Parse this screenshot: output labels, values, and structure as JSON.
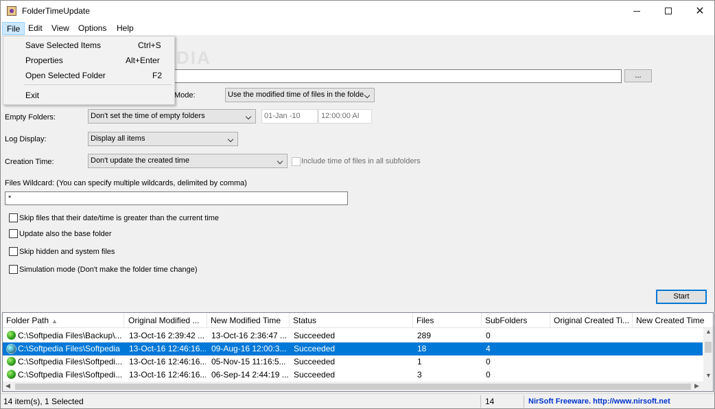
{
  "window": {
    "title": "FolderTimeUpdate"
  },
  "menubar": {
    "items": [
      "File",
      "Edit",
      "View",
      "Options",
      "Help"
    ]
  },
  "file_menu": {
    "items": [
      {
        "label": "Save Selected Items",
        "accel": "Ctrl+S"
      },
      {
        "label": "Properties",
        "accel": "Alt+Enter"
      },
      {
        "label": "Open Selected Folder",
        "accel": "F2"
      },
      {
        "label": "Exit",
        "accel": ""
      }
    ]
  },
  "watermark": "SOFTPEDIA",
  "form": {
    "browse_label": "...",
    "mode_label": "Mode:",
    "mode_value": "Use the modified time of files in the folde",
    "empty_label": "Empty Folders:",
    "empty_value": "Don't set the time of empty folders",
    "empty_date": "01-Jan -10",
    "empty_time": "12:00:00 AI",
    "log_label": "Log Display:",
    "log_value": "Display all items",
    "creation_label": "Creation Time:",
    "creation_value": "Don't update the created time",
    "include_subfolders": "Include time of files in all subfolders",
    "wildcard_label": "Files Wildcard: (You can specify multiple wildcards, delimited by comma)",
    "wildcard_value": "*",
    "options": [
      "Skip files that their date/time is greater than the current time",
      "Update also the base folder",
      "Skip hidden and system files",
      "Simulation mode (Don't make the folder time change)"
    ],
    "start_label": "Start"
  },
  "list": {
    "columns": [
      "Folder Path",
      "Original Modified ...",
      "New Modified Time",
      "Status",
      "Files",
      "SubFolders",
      "Original Created Ti...",
      "New Created Time"
    ],
    "rows": [
      [
        "C:\\Softpedia Files\\Backup\\...",
        "13-Oct-16 2:39:42 ...",
        "13-Oct-16 2:36:47 ...",
        "Succeeded",
        "289",
        "0"
      ],
      [
        "C:\\Softpedia Files\\Softpedia",
        "13-Oct-16 12:46:16...",
        "09-Aug-16 12:00:3...",
        "Succeeded",
        "18",
        "4"
      ],
      [
        "C:\\Softpedia Files\\Softpedi...",
        "13-Oct-16 12:46:16...",
        "05-Nov-15 11:16:5...",
        "Succeeded",
        "1",
        "0"
      ],
      [
        "C:\\Softpedia Files\\Softpedi...",
        "13-Oct-16 12:46:16...",
        "06-Sep-14 2:44:19 ...",
        "Succeeded",
        "3",
        "0"
      ]
    ]
  },
  "status": {
    "items": "14 item(s), 1 Selected",
    "count": "14",
    "link": "NirSoft Freeware.  http://www.nirsoft.net"
  }
}
